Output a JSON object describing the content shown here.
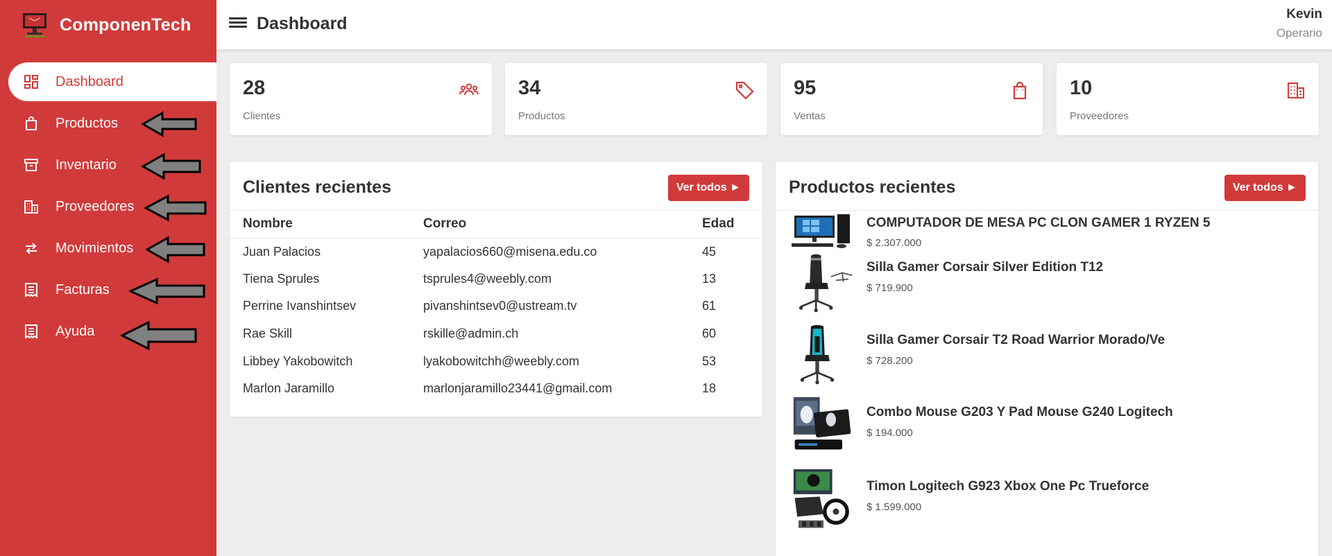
{
  "brand": {
    "name": "ComponenTech"
  },
  "nav": [
    {
      "label": "Dashboard",
      "icon": "dashboard-icon",
      "active": true
    },
    {
      "label": "Productos",
      "icon": "shopping-bag-icon"
    },
    {
      "label": "Inventario",
      "icon": "archive-icon"
    },
    {
      "label": "Proveedores",
      "icon": "building-icon"
    },
    {
      "label": "Movimientos",
      "icon": "swap-arrows-icon"
    },
    {
      "label": "Facturas",
      "icon": "receipt-icon"
    },
    {
      "label": "Ayuda",
      "icon": "receipt-icon"
    }
  ],
  "header": {
    "title": "Dashboard",
    "user_name": "Kevin",
    "user_role": "Operario"
  },
  "stats": [
    {
      "value": "28",
      "label": "Clientes",
      "icon": "users-icon"
    },
    {
      "value": "34",
      "label": "Productos",
      "icon": "tag-icon"
    },
    {
      "value": "95",
      "label": "Ventas",
      "icon": "shopping-bag-icon"
    },
    {
      "value": "10",
      "label": "Proveedores",
      "icon": "building-icon"
    }
  ],
  "clients": {
    "title": "Clientes recientes",
    "button": "Ver todos ►",
    "columns": [
      "Nombre",
      "Correo",
      "Edad"
    ],
    "rows": [
      [
        "Juan Palacios",
        "yapalacios660@misena.edu.co",
        "45"
      ],
      [
        "Tiena Sprules",
        "tsprules4@weebly.com",
        "13"
      ],
      [
        "Perrine Ivanshintsev",
        "pivanshintsev0@ustream.tv",
        "61"
      ],
      [
        "Rae Skill",
        "rskille@admin.ch",
        "60"
      ],
      [
        "Libbey Yakobowitch",
        "lyakobowitchh@weebly.com",
        "53"
      ],
      [
        "Marlon Jaramillo",
        "marlonjaramillo23441@gmail.com",
        "18"
      ]
    ]
  },
  "products": {
    "title": "Productos recientes",
    "button": "Ver todos ►",
    "items": [
      {
        "name": "COMPUTADOR DE MESA PC CLON GAMER 1 RYZEN 5",
        "price": "$ 2.307.000"
      },
      {
        "name": "Silla Gamer Corsair Silver Edition T12",
        "price": "$ 719.900"
      },
      {
        "name": "Silla Gamer Corsair T2 Road Warrior Morado/Ve",
        "price": "$ 728.200"
      },
      {
        "name": "Combo Mouse G203 Y Pad Mouse G240 Logitech",
        "price": "$ 194.000"
      },
      {
        "name": "Timon Logitech G923 Xbox One Pc Trueforce",
        "price": "$ 1.599.000"
      }
    ]
  },
  "colors": {
    "accent": "#d13a3a",
    "background": "#ededed",
    "arrow": "#808080"
  }
}
